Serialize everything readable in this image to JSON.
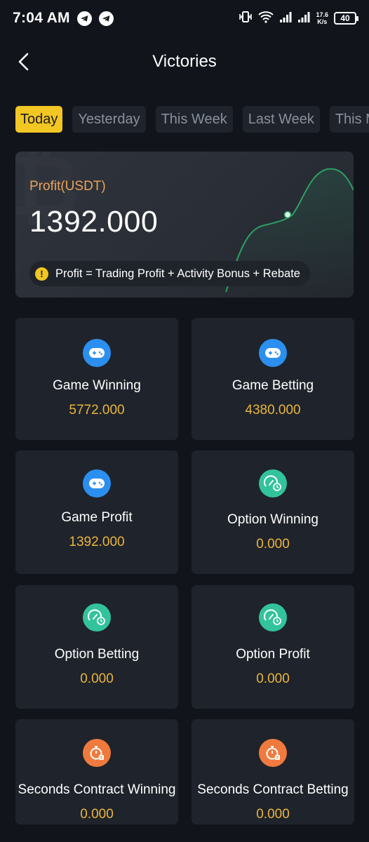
{
  "status_bar": {
    "time": "7:04 AM",
    "speed_top": "17.6",
    "speed_unit": "K/s",
    "battery": "40",
    "icons": [
      "telegram-icon",
      "telegram-icon",
      "vibrate-icon",
      "wifi-icon",
      "signal-icon",
      "signal-icon"
    ]
  },
  "header": {
    "title": "Victories",
    "back_icon": "chevron-left-icon"
  },
  "tabs": [
    {
      "label": "Today",
      "active": true
    },
    {
      "label": "Yesterday",
      "active": false
    },
    {
      "label": "This Week",
      "active": false
    },
    {
      "label": "Last Week",
      "active": false
    },
    {
      "label": "This Month",
      "active": false
    }
  ],
  "profit": {
    "label": "Profit(USDT)",
    "value": "1392.000",
    "formula": "Profit = Trading Profit + Activity Bonus + Rebate",
    "formula_icon": "warning-icon"
  },
  "stats": [
    {
      "label": "Game Winning",
      "value": "5772.000",
      "icon": "gamepad-icon",
      "color": "#2b8ff0"
    },
    {
      "label": "Game Betting",
      "value": "4380.000",
      "icon": "gamepad-icon",
      "color": "#2b8ff0"
    },
    {
      "label": "Game Profit",
      "value": "1392.000",
      "icon": "gamepad-icon",
      "color": "#2b8ff0"
    },
    {
      "label": "Option Winning",
      "value": "0.000",
      "icon": "gauge-clock-icon",
      "color": "#33c39c"
    },
    {
      "label": "Option Betting",
      "value": "0.000",
      "icon": "gauge-clock-icon",
      "color": "#33c39c"
    },
    {
      "label": "Option Profit",
      "value": "0.000",
      "icon": "gauge-clock-icon",
      "color": "#33c39c"
    },
    {
      "label": "Seconds Contract Winning",
      "value": "0.000",
      "icon": "stopwatch-icon",
      "color": "#f07a3d"
    },
    {
      "label": "Seconds Contract Betting",
      "value": "0.000",
      "icon": "stopwatch-icon",
      "color": "#f07a3d"
    }
  ],
  "colors": {
    "background": "#11151b",
    "card": "#1f232b",
    "accent": "#f2c623",
    "value": "#eab53c",
    "profit_label": "#e9a35a"
  }
}
